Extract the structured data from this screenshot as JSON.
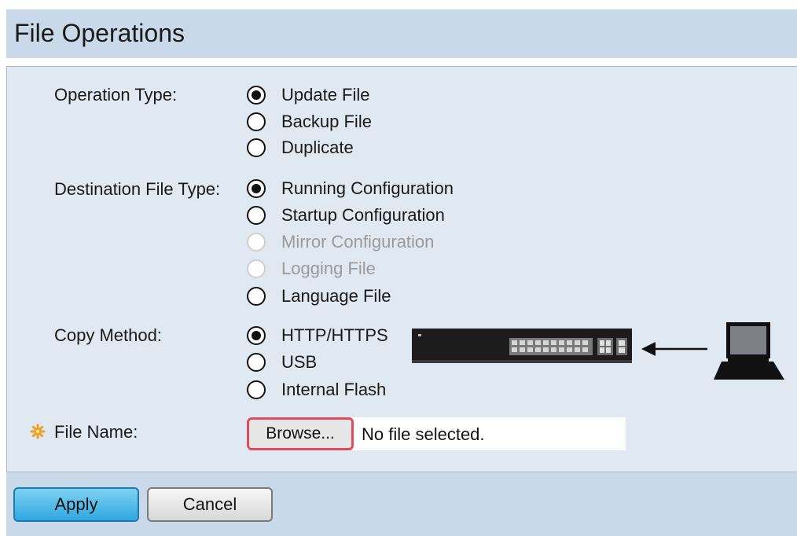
{
  "page": {
    "title": "File Operations"
  },
  "operation_type": {
    "label": "Operation Type:",
    "options": [
      {
        "label": "Update File",
        "selected": true,
        "disabled": false
      },
      {
        "label": "Backup File",
        "selected": false,
        "disabled": false
      },
      {
        "label": "Duplicate",
        "selected": false,
        "disabled": false
      }
    ]
  },
  "destination_file_type": {
    "label": "Destination File Type:",
    "options": [
      {
        "label": "Running Configuration",
        "selected": true,
        "disabled": false
      },
      {
        "label": "Startup Configuration",
        "selected": false,
        "disabled": false
      },
      {
        "label": "Mirror Configuration",
        "selected": false,
        "disabled": true
      },
      {
        "label": "Logging File",
        "selected": false,
        "disabled": true
      },
      {
        "label": "Language File",
        "selected": false,
        "disabled": false
      }
    ]
  },
  "copy_method": {
    "label": "Copy Method:",
    "options": [
      {
        "label": "HTTP/HTTPS",
        "selected": true,
        "disabled": false
      },
      {
        "label": "USB",
        "selected": false,
        "disabled": false
      },
      {
        "label": "Internal Flash",
        "selected": false,
        "disabled": false
      }
    ]
  },
  "file_name": {
    "label": "File Name:",
    "browse_label": "Browse...",
    "status": "No file selected.",
    "required_icon": "asterisk-gear-icon"
  },
  "buttons": {
    "apply": "Apply",
    "cancel": "Cancel"
  },
  "colors": {
    "title_bar": "#c9d9ea",
    "panel": "#e0e8f2",
    "apply_button": "#2fa7e0",
    "highlight": "#e34a5b",
    "required_icon": "#f0a020"
  },
  "diagram": {
    "icons": [
      "switch-icon",
      "arrow-left-icon",
      "laptop-icon"
    ]
  }
}
